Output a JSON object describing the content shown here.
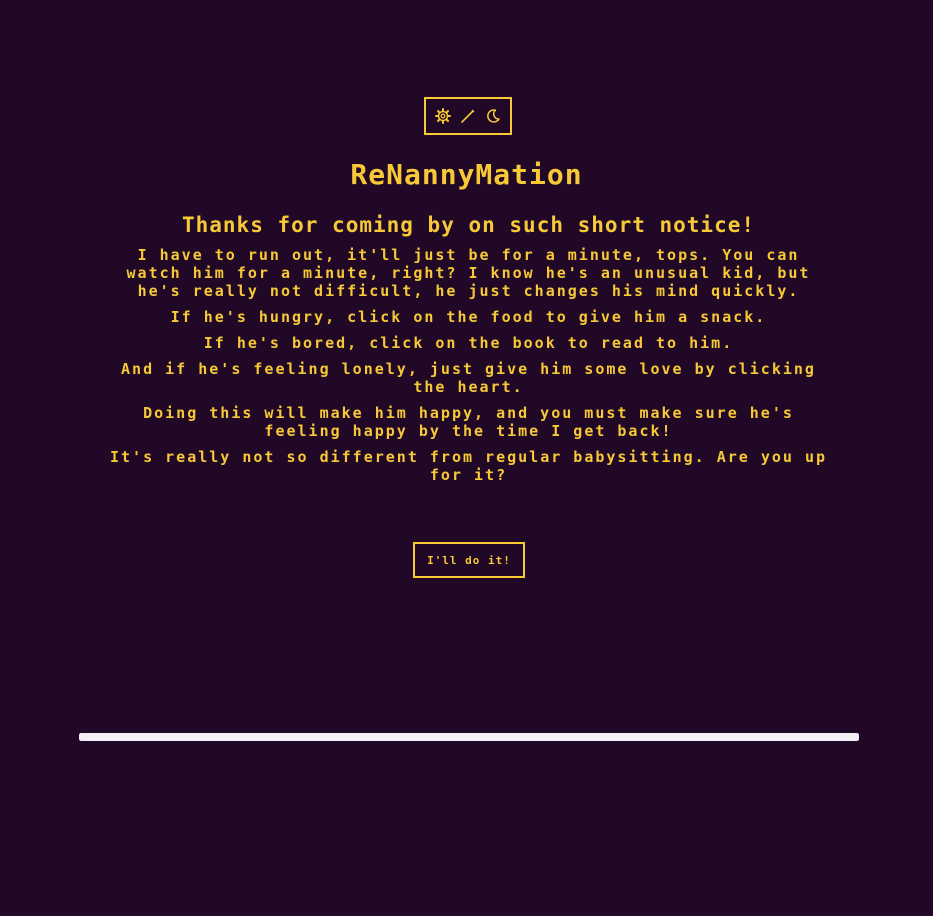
{
  "toolbar": {
    "icons": [
      "gear-icon",
      "wand-icon",
      "moon-icon"
    ]
  },
  "app": {
    "title": "ReNannyMation"
  },
  "intro": {
    "heading": "Thanks for coming by on such short notice!",
    "paragraphs": [
      "I have to run out, it'll just be for a minute, tops. You can watch him for a minute, right? I know he's an unusual kid, but he's really not difficult, he just changes his mind quickly.",
      "If he's hungry, click on the food to give him a snack.",
      "If he's bored, click on the book to read to him.",
      "And if he's feeling lonely, just give him some love by clicking the heart.",
      "Doing this will make him happy, and you must make sure he's feeling happy by the time I get back!",
      "It's really not so different from regular babysitting. Are you up for it?"
    ],
    "button_label": "I'll do it!"
  },
  "progress": {
    "fraction": 1.0
  },
  "colors": {
    "background": "#200826",
    "accent": "#f7c936",
    "progress_fill": "#f2eef3"
  }
}
